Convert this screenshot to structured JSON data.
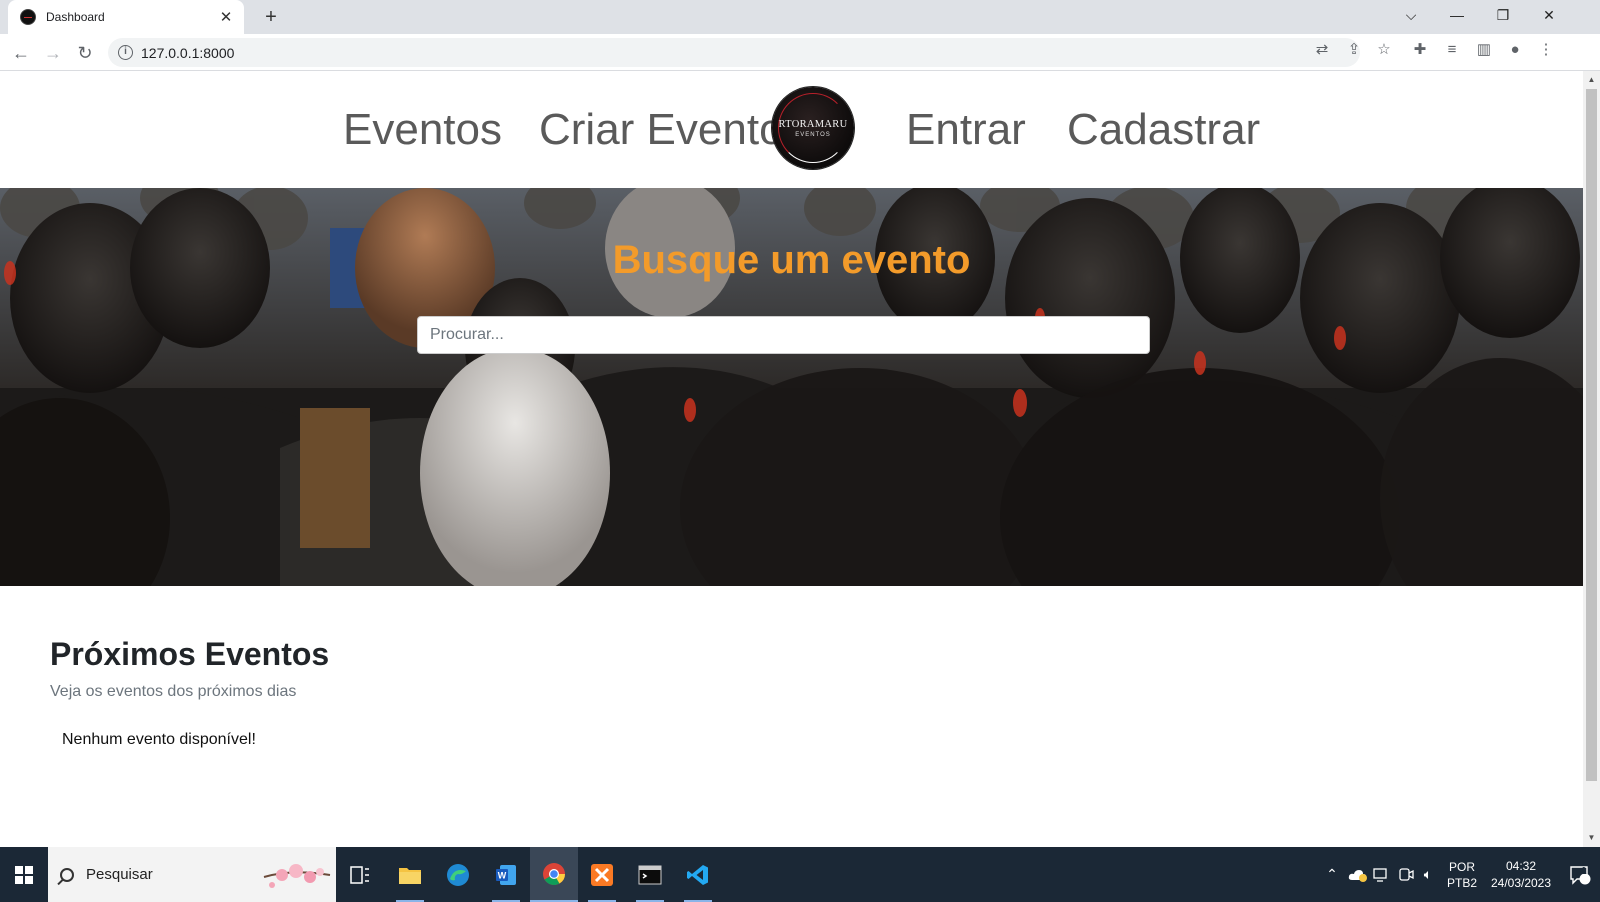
{
  "browser": {
    "tab_title": "Dashboard",
    "tab_close": "✕",
    "new_tab": "+",
    "url": "127.0.0.1:8000",
    "win_controls": {
      "dropdown": "⌵",
      "minimize": "—",
      "restore": "❐",
      "close": "✕"
    }
  },
  "site": {
    "nav": {
      "eventos": "Eventos",
      "criar_evento": "Criar Evento",
      "entrar": "Entrar",
      "cadastrar": "Cadastrar"
    },
    "logo": {
      "main": "RTORAMARU",
      "sub": "EVENTOS"
    },
    "hero": {
      "title": "Busque um evento",
      "search_placeholder": "Procurar..."
    },
    "events": {
      "title": "Próximos Eventos",
      "subtitle": "Veja os eventos dos próximos dias",
      "empty_message": "Nenhum evento disponível!"
    }
  },
  "taskbar": {
    "search_text": "Pesquisar",
    "lang_top": "POR",
    "lang_bottom": "PTB2",
    "time": "04:32",
    "date": "24/03/2023",
    "notification_count": "1"
  },
  "colors": {
    "hero_title": "#f39b2a",
    "nav_link": "#5a5a5a",
    "taskbar": "#1b2836"
  }
}
